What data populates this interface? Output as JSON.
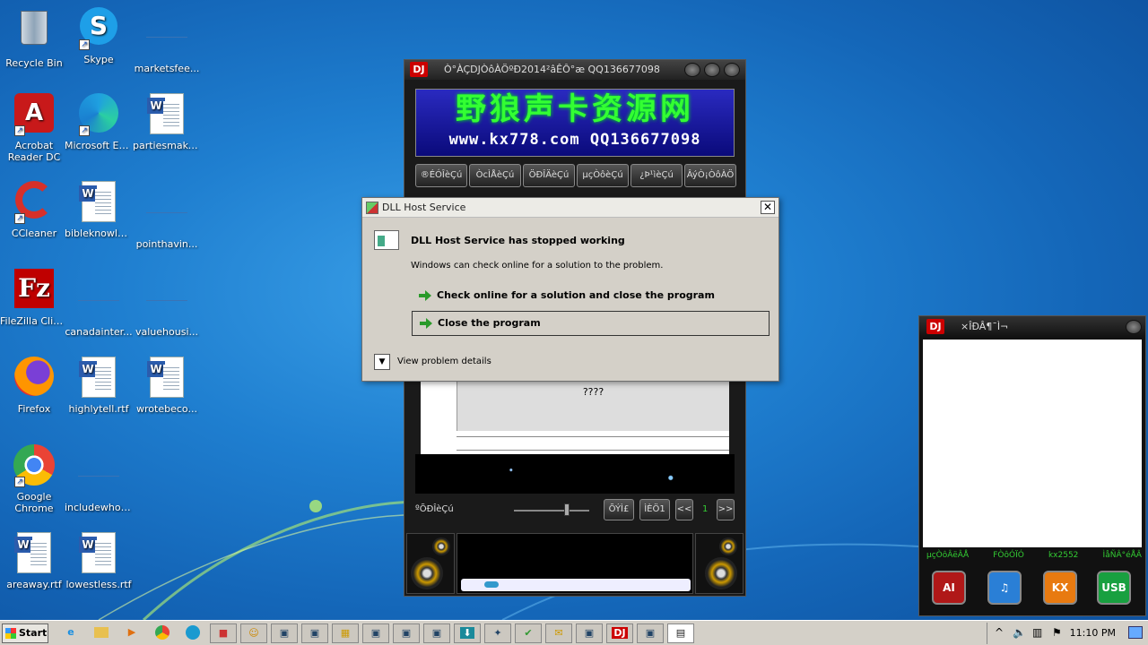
{
  "desktop": {
    "icons": [
      {
        "label": "Recycle Bin",
        "icon": "recycle-bin-icon"
      },
      {
        "label": "Skype",
        "icon": "skype-icon"
      },
      {
        "label": "marketsfee...",
        "icon": "blank-file-icon"
      },
      {
        "label": "Acrobat Reader DC",
        "icon": "acrobat-icon"
      },
      {
        "label": "Microsoft Edge",
        "icon": "edge-icon"
      },
      {
        "label": "partiesmake...",
        "icon": "word-doc-icon"
      },
      {
        "label": "CCleaner",
        "icon": "ccleaner-icon"
      },
      {
        "label": "bibleknowle...",
        "icon": "word-doc-icon"
      },
      {
        "label": "pointhavin...",
        "icon": "blank-file-icon"
      },
      {
        "label": "FileZilla Client",
        "icon": "filezilla-icon"
      },
      {
        "label": "canadainter...",
        "icon": "blank-file-icon"
      },
      {
        "label": "valuehousi...",
        "icon": "blank-file-icon"
      },
      {
        "label": "Firefox",
        "icon": "firefox-icon"
      },
      {
        "label": "highlytell.rtf",
        "icon": "word-doc-icon"
      },
      {
        "label": "wrotebeco...",
        "icon": "word-doc-icon"
      },
      {
        "label": "Google Chrome",
        "icon": "chrome-icon"
      },
      {
        "label": "includewhol...",
        "icon": "blank-file-icon"
      },
      {
        "label": "areaway.rtf",
        "icon": "word-doc-icon"
      },
      {
        "label": "lowestless.rtf",
        "icon": "word-doc-icon"
      }
    ]
  },
  "dj_player": {
    "logo": "DJ",
    "title": "Ò°ÀÇDJÒôÀÖºÐ2014²âÊÔ°æ QQ136677098",
    "banner_text": "野狼声卡资源网",
    "banner_url": "www.kx778.com  QQ136677098",
    "buttons": [
      "®ÉÓÎèÇú",
      "ÒcÌÅèÇú",
      "ÖÐÎÄèÇú",
      "µçÒôèÇú",
      "¿Þ¹ìèÇú",
      "ÂýÒ¡ÒôÀÖ"
    ],
    "list_text": "????",
    "row_label": "ºÕÐÎèÇú",
    "btn_a": "ÕÝÌ£",
    "btn_b": "ÌÈÖ1",
    "prev": "<<",
    "next": ">>",
    "page": "1"
  },
  "dj_panel": {
    "logo": "DJ",
    "title": "×ÎÐÂ¶¯Ì¬",
    "links": [
      "µçÒôÂëÂÅ",
      "FÒôÓÏÓ",
      "kx2552",
      "ÌåÑÂ°éÅÂ"
    ],
    "apps": [
      "AI",
      "♫",
      "KX",
      "USB"
    ]
  },
  "dialog": {
    "title": "DLL Host Service",
    "close": "✕",
    "heading": "DLL Host Service has stopped working",
    "subtext": "Windows can check online for a solution to the problem.",
    "option_check": "Check online for a solution and close the program",
    "option_close": "Close the program",
    "details": "View problem details",
    "details_chevron": "▼"
  },
  "taskbar": {
    "start": "Start",
    "time": "11:10 PM",
    "tray_up": "^",
    "tray_icons": [
      "volume-icon",
      "network-icon",
      "flag-icon"
    ],
    "items": [
      "ie-icon",
      "explorer-icon",
      "media-icon",
      "chrome-icon",
      "edge-icon",
      "app-icon",
      "user-icon",
      "window-icon",
      "window-icon",
      "folder-icon",
      "window-icon",
      "window-icon",
      "window-icon",
      "download-icon",
      "bird-icon",
      "check-icon",
      "note-icon",
      "window-icon",
      "dj-icon",
      "window-icon",
      "task-icon"
    ],
    "dj_label": "DJ"
  }
}
